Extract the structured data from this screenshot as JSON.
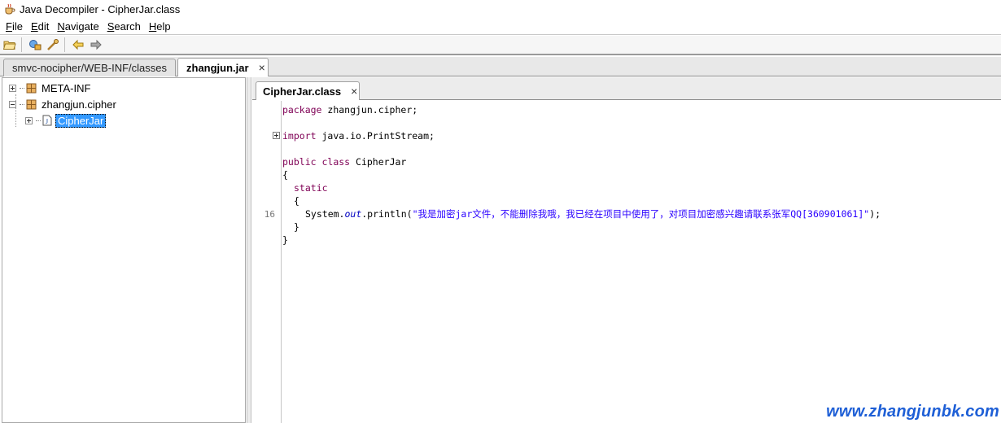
{
  "window": {
    "title": "Java Decompiler - CipherJar.class",
    "app_icon": "coffee-cup-icon"
  },
  "menubar": {
    "items": [
      {
        "mnemonic": "F",
        "rest": "ile"
      },
      {
        "mnemonic": "E",
        "rest": "dit"
      },
      {
        "mnemonic": "N",
        "rest": "avigate"
      },
      {
        "mnemonic": "S",
        "rest": "earch"
      },
      {
        "mnemonic": "H",
        "rest": "elp"
      }
    ]
  },
  "toolbar": {
    "buttons": [
      "open-file-icon",
      "open-type-icon",
      "open-type-hierarchy-icon",
      "back-icon",
      "forward-icon"
    ]
  },
  "outer_tabs": [
    {
      "label": "smvc-nocipher/WEB-INF/classes",
      "active": false
    },
    {
      "label": "zhangjun.jar",
      "active": true,
      "close": "×"
    }
  ],
  "tree": {
    "items": [
      {
        "label": "META-INF",
        "expanded": false,
        "icon": "package-icon"
      },
      {
        "label": "zhangjun.cipher",
        "expanded": true,
        "icon": "package-icon"
      },
      {
        "label": "CipherJar",
        "expanded": false,
        "icon": "java-file-icon",
        "selected": true
      }
    ]
  },
  "inner_tabs": [
    {
      "label": "CipherJar.class",
      "active": true,
      "close": "×"
    }
  ],
  "editor": {
    "line_number": "16",
    "lines": {
      "package_kw": "package",
      "package_name": " zhangjun.cipher;",
      "import_kw": "import",
      "import_name": " java.io.PrintStream;",
      "public_kw": "public",
      "class_kw": "class",
      "class_name": " CipherJar",
      "open_brace": "{",
      "static_kw": "static",
      "static_open": "{",
      "println_prefix": "System.",
      "println_field": "out",
      "println_method": ".println(",
      "println_string": "\"我是加密jar文件，不能删除我哦，我已经在项目中使用了，对项目加密感兴趣请联系张军QQ[360901061]\"",
      "println_suffix": ");",
      "static_close": "}",
      "close_brace": "}"
    }
  },
  "watermark": "www.zhangjunbk.com"
}
